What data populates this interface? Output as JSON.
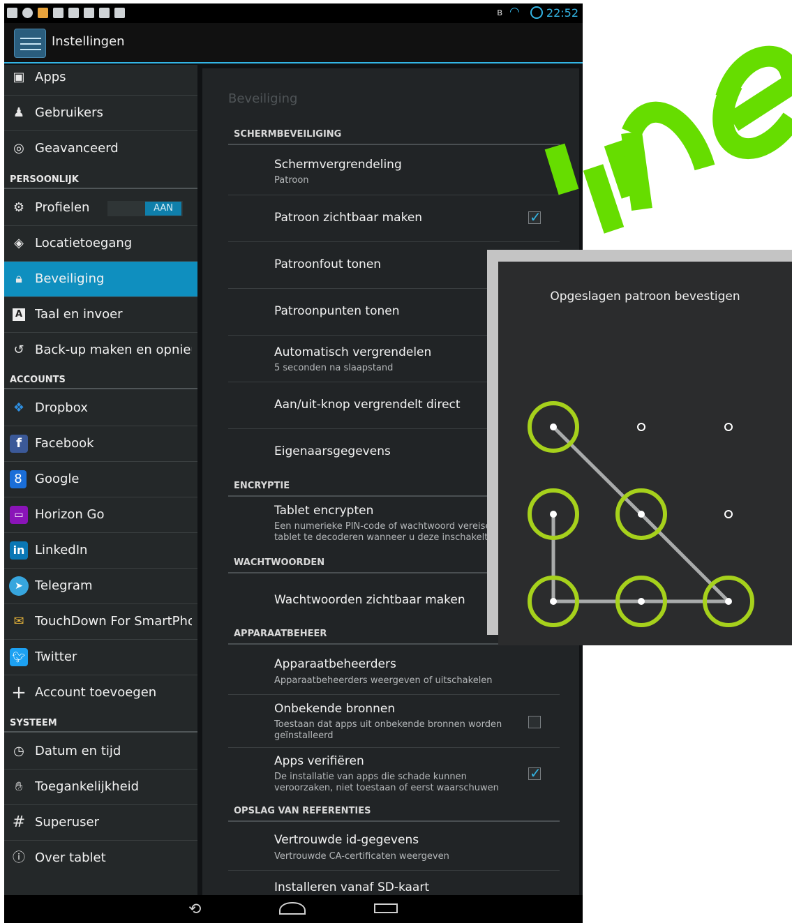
{
  "watermark": {
    "text": "online",
    "color": "#66dd00"
  },
  "status_bar": {
    "time": "22:52",
    "accent": "#33b5e5"
  },
  "action_bar": {
    "title": "Instellingen"
  },
  "sidebar": {
    "items": [
      {
        "label": "Apps",
        "icon": "image-icon"
      },
      {
        "label": "Gebruikers",
        "icon": "person-icon"
      },
      {
        "label": "Geavanceerd",
        "icon": "target-icon"
      },
      {
        "header": "PERSOONLIJK"
      },
      {
        "label": "Profielen",
        "icon": "profiles-icon",
        "toggle": "AAN"
      },
      {
        "label": "Locatietoegang",
        "icon": "location-icon"
      },
      {
        "label": "Beveiliging",
        "icon": "lock-icon",
        "active": true
      },
      {
        "label": "Taal en invoer",
        "icon": "keyboard-icon"
      },
      {
        "label": "Back-up maken en opnieuw",
        "icon": "backup-icon"
      },
      {
        "header": "ACCOUNTS"
      },
      {
        "label": "Dropbox",
        "icon": "dropbox-icon"
      },
      {
        "label": "Facebook",
        "icon": "facebook-icon"
      },
      {
        "label": "Google",
        "icon": "google-icon"
      },
      {
        "label": "Horizon Go",
        "icon": "horizon-go-icon"
      },
      {
        "label": "LinkedIn",
        "icon": "linkedin-icon"
      },
      {
        "label": "Telegram",
        "icon": "telegram-icon"
      },
      {
        "label": "TouchDown For SmartPhones",
        "icon": "touchdown-icon"
      },
      {
        "label": "Twitter",
        "icon": "twitter-icon"
      },
      {
        "label": "Account toevoegen",
        "icon": "plus-icon"
      },
      {
        "header": "SYSTEEM"
      },
      {
        "label": "Datum en tijd",
        "icon": "clock-icon"
      },
      {
        "label": "Toegankelijkheid",
        "icon": "hand-icon"
      },
      {
        "label": "Superuser",
        "icon": "hash-icon"
      },
      {
        "label": "Over tablet",
        "icon": "info-icon"
      }
    ]
  },
  "main": {
    "title": "Beveiliging",
    "sections": [
      {
        "header": "SCHERMBEVEILIGING",
        "items": [
          {
            "title": "Schermvergrendeling",
            "subtitle": "Patroon"
          },
          {
            "title": "Patroon zichtbaar maken",
            "checkbox": true
          },
          {
            "title": "Patroonfout tonen",
            "checkbox": true
          },
          {
            "title": "Patroonpunten tonen"
          },
          {
            "title": "Automatisch vergrendelen",
            "subtitle": "5 seconden na slaapstand"
          },
          {
            "title": "Aan/uit-knop vergrendelt direct"
          },
          {
            "title": "Eigenaarsgegevens"
          }
        ]
      },
      {
        "header": "ENCRYPTIE",
        "items": [
          {
            "title": "Tablet encrypten",
            "subtitle": "Een numerieke PIN-code of wachtwoord vereisen om",
            "subtitle2": "tablet te decoderen wanneer u deze inschakelt"
          }
        ]
      },
      {
        "header": "WACHTWOORDEN",
        "items": [
          {
            "title": "Wachtwoorden zichtbaar maken"
          }
        ]
      },
      {
        "header": "APPARAATBEHEER",
        "items": [
          {
            "title": "Apparaatbeheerders",
            "subtitle": "Apparaatbeheerders weergeven of uitschakelen"
          },
          {
            "title": "Onbekende bronnen",
            "subtitle": "Toestaan dat apps uit onbekende bronnen worden",
            "subtitle2": "geïnstalleerd",
            "checkbox": false
          },
          {
            "title": "Apps verifiëren",
            "subtitle": "De installatie van apps die schade kunnen",
            "subtitle2": "veroorzaken, niet toestaan of eerst waarschuwen",
            "checkbox": true
          }
        ]
      },
      {
        "header": "OPSLAG VAN REFERENTIES",
        "items": [
          {
            "title": "Vertrouwde id-gegevens",
            "subtitle": "Vertrouwde CA-certificaten weergeven"
          },
          {
            "title": "Installeren vanaf SD-kaart"
          }
        ]
      }
    ]
  },
  "pattern_dialog": {
    "title": "Opgeslagen patroon bevestigen",
    "pattern_color": "#a6d11c",
    "selected_sequence": [
      "1-1",
      "2-2",
      "3-3",
      "3-2",
      "3-1",
      "2-1"
    ]
  }
}
